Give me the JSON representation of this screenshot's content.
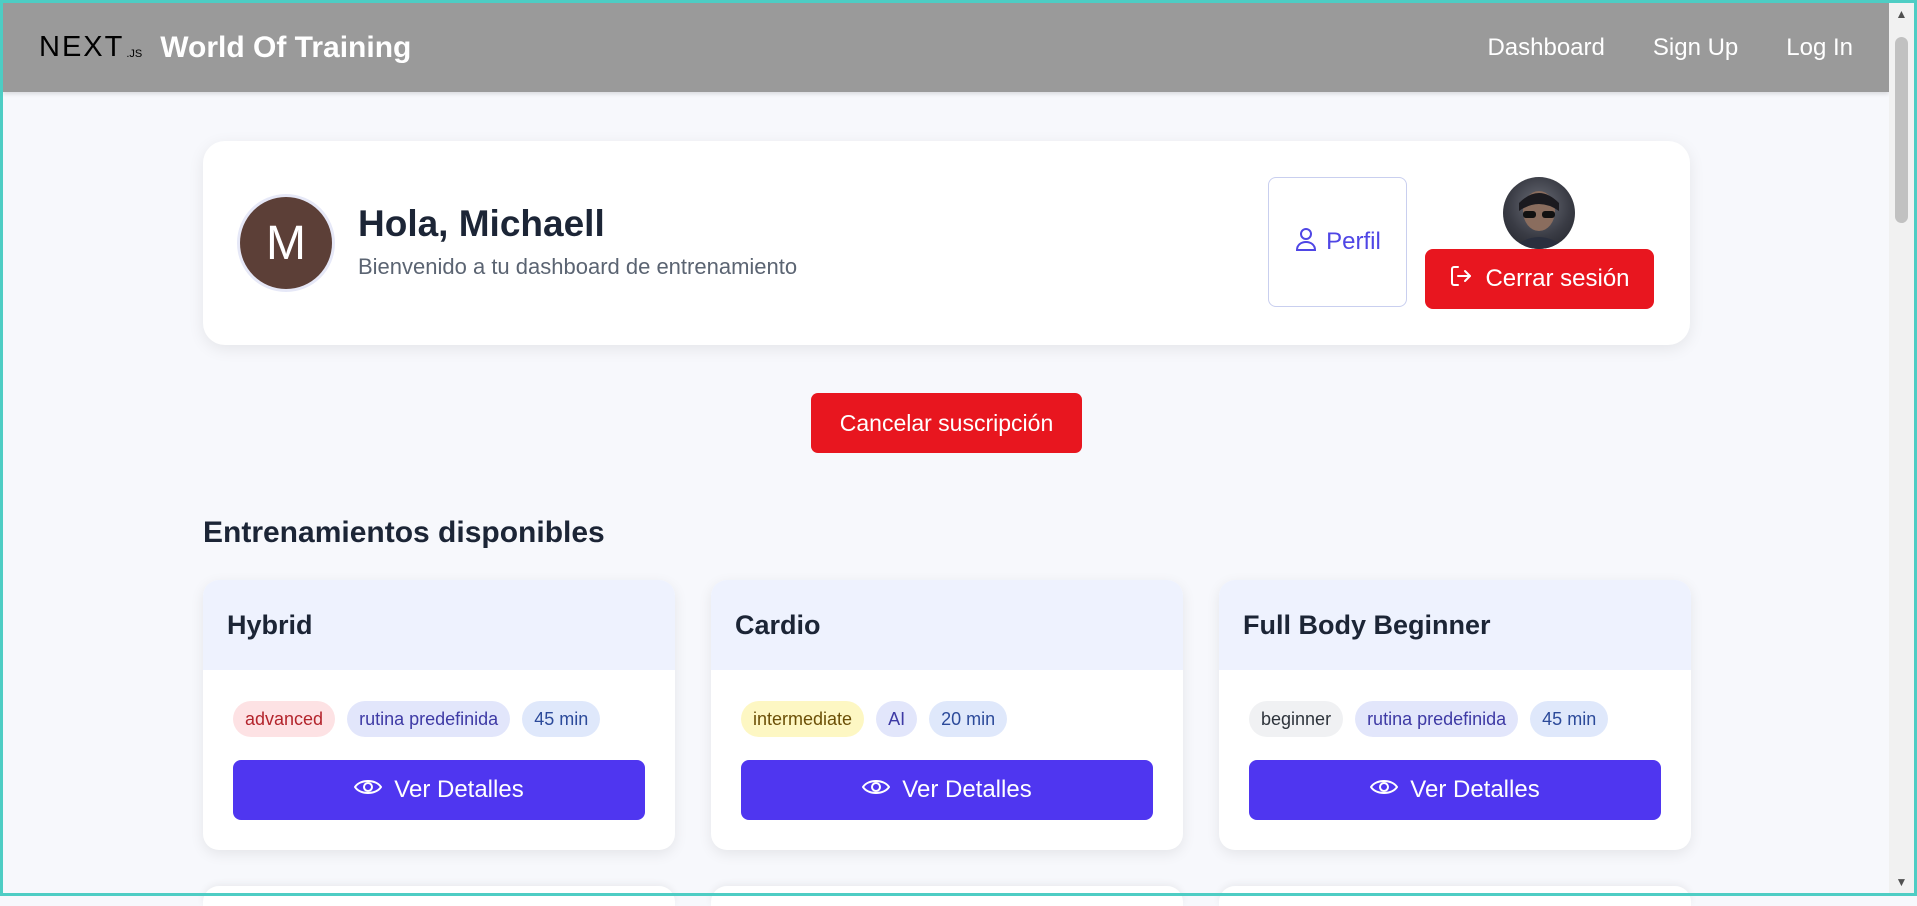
{
  "header": {
    "logo_main": "NEXT",
    "logo_sub": ".JS",
    "app_title": "World Of Training",
    "nav": [
      {
        "label": "Dashboard"
      },
      {
        "label": "Sign Up"
      },
      {
        "label": "Log In"
      }
    ]
  },
  "welcome": {
    "avatar_initial": "M",
    "greeting": "Hola, Michaell",
    "subtitle": "Bienvenido a tu dashboard de entrenamiento",
    "profile_button": "Perfil",
    "logout_button": "Cerrar sesión"
  },
  "cancel_subscription_button": "Cancelar suscripción",
  "section_title": "Entrenamientos disponibles",
  "trainings": [
    {
      "title": "Hybrid",
      "level": "advanced",
      "type": "rutina predefinida",
      "duration": "45 min",
      "button": "Ver Detalles"
    },
    {
      "title": "Cardio",
      "level": "intermediate",
      "type": "AI",
      "duration": "20 min",
      "button": "Ver Detalles"
    },
    {
      "title": "Full Body Beginner",
      "level": "beginner",
      "type": "rutina predefinida",
      "duration": "45 min",
      "button": "Ver Detalles"
    }
  ],
  "colors": {
    "header_bg": "#9a9a9a",
    "primary": "#4f36f0",
    "danger": "#e8161f",
    "card_head_bg": "#eef2fe"
  },
  "icons": {
    "profile": "user-icon",
    "logout": "logout-icon",
    "details": "eye-icon"
  }
}
